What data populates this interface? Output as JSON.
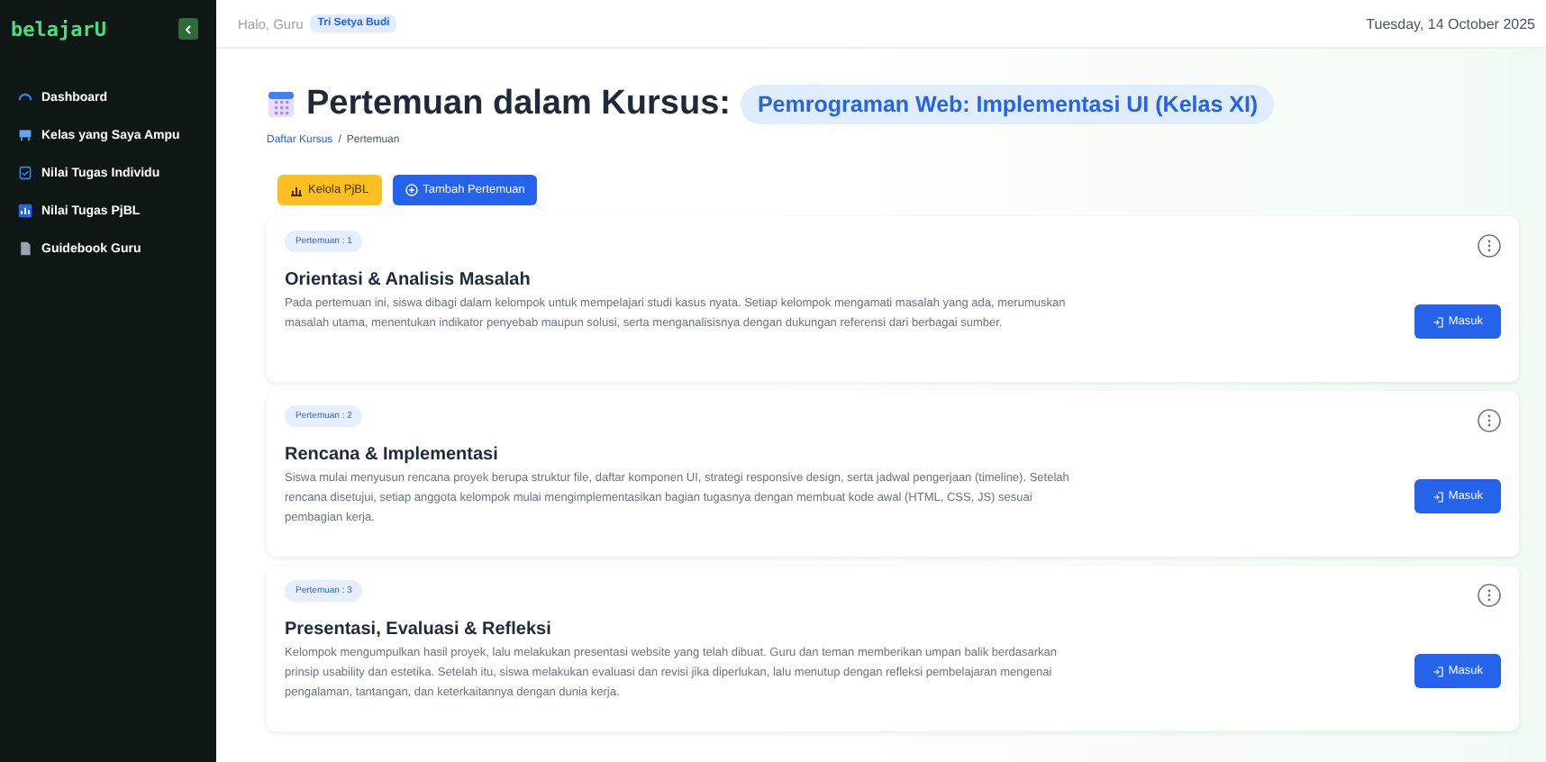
{
  "sidebar": {
    "logo": "belajarU",
    "items": [
      {
        "label": "Dashboard",
        "selected": false
      },
      {
        "label": "Kelas yang Saya Ampu",
        "selected": false
      },
      {
        "label": "Nilai Tugas Individu",
        "selected": false
      },
      {
        "label": "Nilai Tugas PjBL",
        "selected": false
      },
      {
        "label": "Guidebook Guru",
        "selected": false
      }
    ]
  },
  "topbar": {
    "greeting": "Halo, Guru",
    "user": "Tri Setya Budi",
    "date": "Tuesday, 14 October 2025"
  },
  "page": {
    "title": "Pertemuan dalam Kursus:",
    "course": "Pemrograman Web: Implementasi UI (Kelas XI)",
    "breadcrumb": {
      "items": [
        "Daftar Kursus",
        "Pertemuan"
      ],
      "separator": "/"
    }
  },
  "actions": [
    {
      "label": "Kelola PjBL",
      "kind": "warning"
    },
    {
      "label": "Tambah Pertemuan",
      "kind": "primary"
    }
  ],
  "meetings": [
    {
      "badge": "Pertemuan : 1",
      "title": "Orientasi & Analisis Masalah",
      "description": "Pada pertemuan ini, siswa dibagi dalam kelompok untuk mempelajari studi kasus nyata. Setiap kelompok mengamati masalah yang ada, merumuskan masalah utama, menentukan indikator penyebab maupun solusi, serta menganalisisnya dengan dukungan referensi dari berbagai sumber.",
      "button": "Masuk"
    },
    {
      "badge": "Pertemuan : 2",
      "title": "Rencana & Implementasi",
      "description": "Siswa mulai menyusun rencana proyek berupa struktur file, daftar komponen UI, strategi responsive design, serta jadwal pengerjaan (timeline). Setelah rencana disetujui, setiap anggota kelompok mulai mengimplementasikan bagian tugasnya dengan membuat kode awal (HTML, CSS, JS) sesuai pembagian kerja.",
      "button": "Masuk"
    },
    {
      "badge": "Pertemuan : 3",
      "title": "Presentasi, Evaluasi & Refleksi",
      "description": "Kelompok mengumpulkan hasil proyek, lalu melakukan presentasi website yang telah dibuat. Guru dan teman memberikan umpan balik berdasarkan prinsip usability dan estetika. Setelah itu, siswa melakukan evaluasi dan revisi jika diperlukan, lalu menutup dengan refleksi pembelajaran mengenai pengalaman, tantangan, dan keterkaitannya dengan dunia kerja.",
      "button": "Masuk"
    }
  ]
}
